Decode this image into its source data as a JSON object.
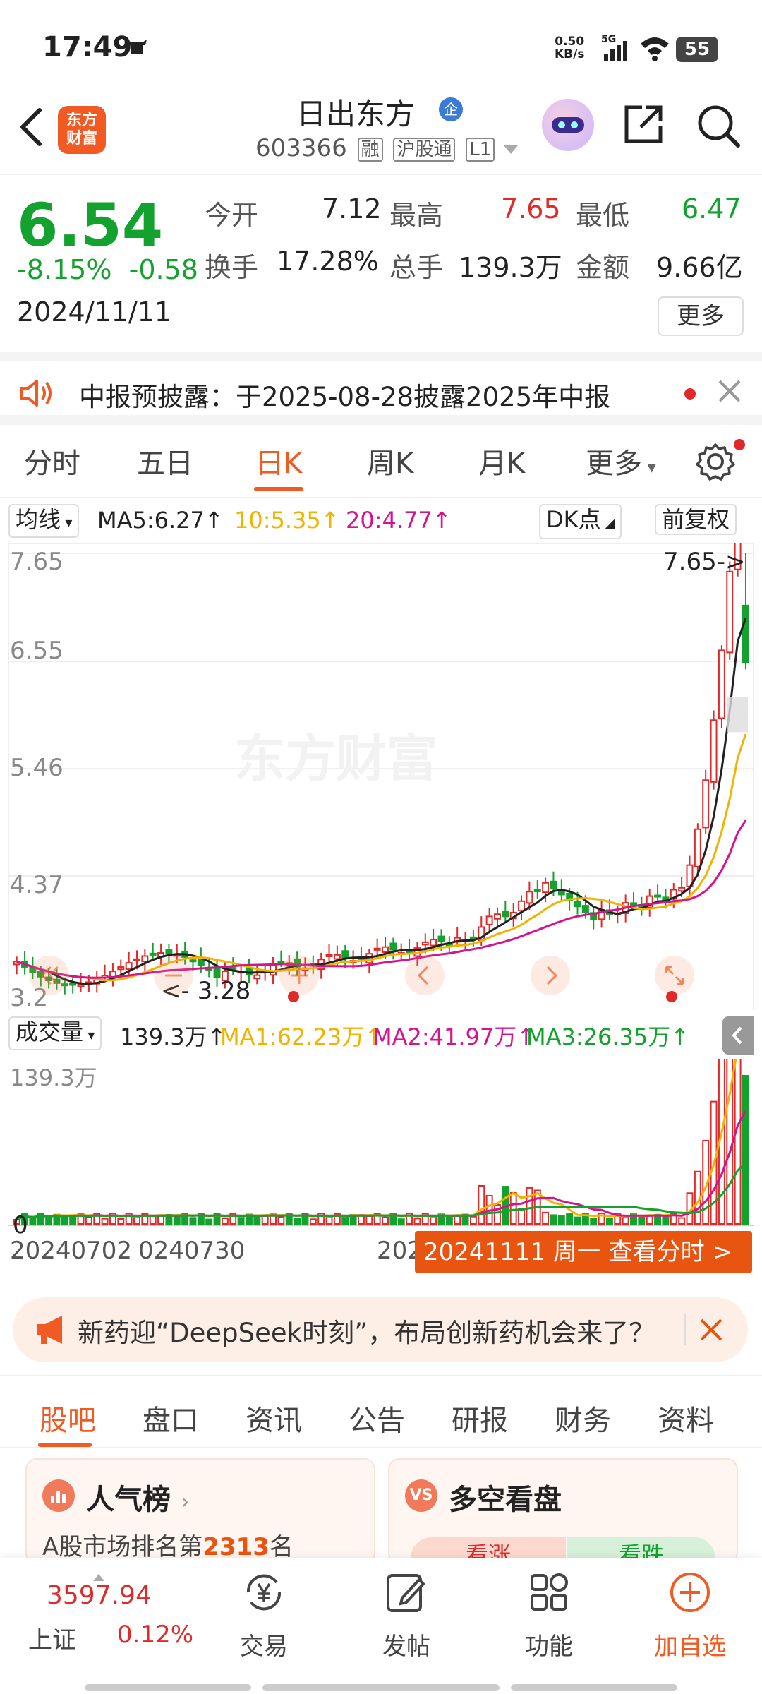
{
  "status_bar": {
    "time": "17:49",
    "net_speed": "0.50",
    "net_unit": "KB/s",
    "signal": "5G",
    "battery": "55"
  },
  "header": {
    "logo_line1": "东方",
    "logo_line2": "财富",
    "stock_name": "日出东方",
    "badge": "企",
    "code": "603366",
    "tags": [
      "融",
      "沪股通",
      "L1"
    ]
  },
  "quote": {
    "price": "6.54",
    "change_pct": "-8.15%",
    "change": "-0.58",
    "date": "2024/11/11",
    "open_label": "今开",
    "open": "7.12",
    "high_label": "最高",
    "high": "7.65",
    "low_label": "最低",
    "low": "6.47",
    "turnover_label": "换手",
    "turnover": "17.28%",
    "volume_label": "总手",
    "volume": "139.3万",
    "amount_label": "金额",
    "amount": "9.66亿",
    "more": "更多"
  },
  "notice": {
    "text": "中报预披露：于2025-08-28披露2025年中报"
  },
  "chart_tabs": [
    "分时",
    "五日",
    "日K",
    "周K",
    "月K",
    "更多"
  ],
  "active_chart_tab": "日K",
  "ma_bar": {
    "select": "均线",
    "ma5": "MA5:6.27",
    "ma10": "10:5.35",
    "ma20": "20:4.77",
    "dk": "DK点",
    "adjust": "前复权"
  },
  "kchart": {
    "y_ticks": [
      "7.65",
      "6.55",
      "5.46",
      "4.37",
      "3.2"
    ],
    "high_marker": "7.65->",
    "low_marker": "3.28",
    "watermark": "东方财富"
  },
  "vol_bar": {
    "select": "成交量",
    "vol": "139.3万",
    "ma1": "MA1:62.23万",
    "ma2": "MA2:41.97万",
    "ma3": "MA3:26.35万",
    "max": "139.3万",
    "zero": "0"
  },
  "dates": {
    "d1": "20240702",
    "d2": "0240730",
    "d3": "202",
    "bar": "20241111 周一 查看分时 >"
  },
  "colors": {
    "up": "#e02a2a",
    "down": "#13a22e",
    "accent": "#f15a22",
    "ma5": "#222222",
    "ma10": "#f0b400",
    "ma20": "#d4148c"
  },
  "ad": {
    "text": "新药迎“DeepSeek时刻”，布局创新药机会来了？"
  },
  "bottom_tabs": [
    "股吧",
    "盘口",
    "资讯",
    "公告",
    "研报",
    "财务",
    "资料"
  ],
  "active_bottom_tab": "股吧",
  "cards": {
    "popular_title": "人气榜",
    "popular_sub_pre": "A股市场排名第",
    "popular_rank": "2313",
    "popular_sub_post": "名",
    "longshort_title": "多空看盘",
    "bull": "看涨",
    "bear": "看跌"
  },
  "nav": {
    "index_value": "3597.94",
    "index_name": "上证",
    "index_change": "0.12%",
    "trade": "交易",
    "post": "发帖",
    "func": "功能",
    "add": "加自选"
  },
  "chart_data": {
    "type": "candlestick",
    "x_start": "20240702",
    "x_end": "20241111",
    "ylim": [
      3.2,
      7.65
    ],
    "last_candle": {
      "date": "20241111",
      "open": 7.12,
      "high": 7.65,
      "low": 6.47,
      "close": 6.54
    },
    "ma": {
      "MA5": 6.27,
      "MA10": 5.35,
      "MA20": 4.77
    },
    "volume_last": "139.3万",
    "volume_ma": {
      "MA1": "62.23万",
      "MA2": "41.97万",
      "MA3": "26.35万"
    }
  }
}
